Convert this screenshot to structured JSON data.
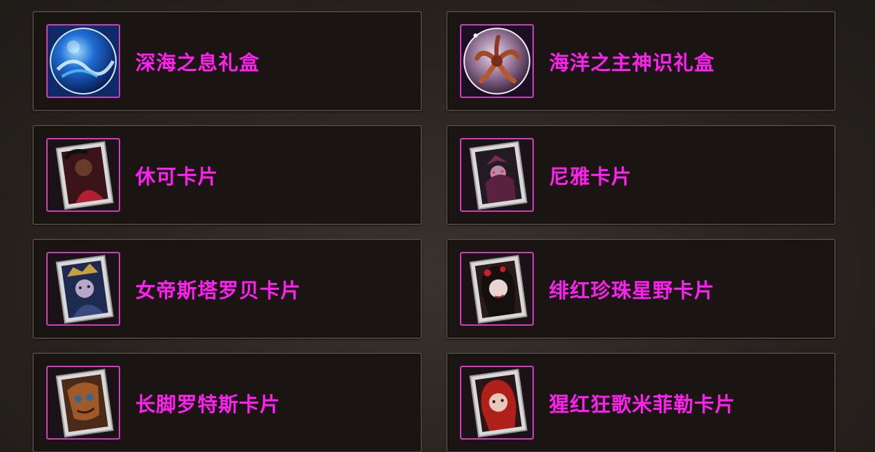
{
  "theme": {
    "name_color": "#ff1ff0",
    "frame_color": "#d43dbb"
  },
  "items": [
    {
      "name": "深海之息礼盒",
      "icon": "ocean-orb-icon"
    },
    {
      "name": "海洋之主神识礼盒",
      "icon": "tentacle-orb-icon"
    },
    {
      "name": "休可卡片",
      "icon": "character-card-icon"
    },
    {
      "name": "尼雅卡片",
      "icon": "character-card-icon"
    },
    {
      "name": "女帝斯塔罗贝卡片",
      "icon": "character-card-icon"
    },
    {
      "name": "绯红珍珠星野卡片",
      "icon": "character-card-icon"
    },
    {
      "name": "长脚罗特斯卡片",
      "icon": "character-card-icon"
    },
    {
      "name": "猩红狂歌米菲勒卡片",
      "icon": "character-card-icon"
    }
  ]
}
